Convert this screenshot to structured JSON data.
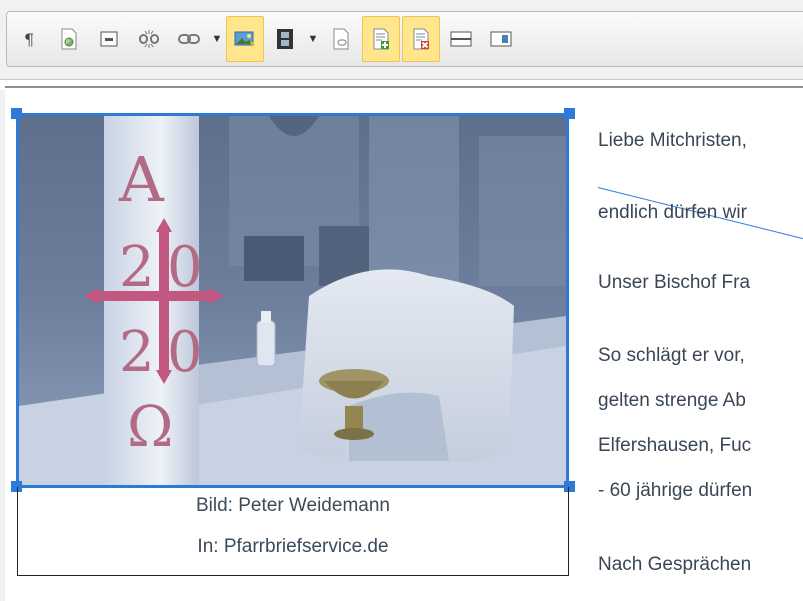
{
  "toolbar": {
    "buttons": [
      {
        "name": "paragraph-marks-icon",
        "active": false
      },
      {
        "name": "insert-page-icon",
        "active": false
      },
      {
        "name": "insert-field-icon",
        "active": false
      },
      {
        "name": "unlink-icon",
        "active": false
      },
      {
        "name": "link-icon",
        "active": false
      },
      {
        "name": "insert-image-icon",
        "active": true
      },
      {
        "name": "insert-media-icon",
        "active": false
      },
      {
        "name": "insert-document-link-icon",
        "active": false
      },
      {
        "name": "insert-table-row-icon",
        "active": true
      },
      {
        "name": "delete-table-row-icon",
        "active": true
      },
      {
        "name": "horizontal-rule-icon",
        "active": false
      },
      {
        "name": "template-icon",
        "active": false
      }
    ]
  },
  "image": {
    "caption_line1": "Bild: Peter Weidemann",
    "caption_line2": "In: Pfarrbriefservice.de",
    "candle_symbols": [
      "A",
      "2",
      "0",
      "2",
      "0",
      "Ω"
    ]
  },
  "body_lines": [
    "Liebe Mitchristen,",
    "endlich dürfen wir",
    "Unser Bischof Fra",
    "So schlägt er vor,",
    "gelten strenge Ab",
    "Elfershausen, Fuc",
    "- 60 jährige dürfen",
    "Nach Gesprächen"
  ],
  "colors": {
    "accent": "#2e7bd6",
    "toolbar_active": "#ffe58c"
  }
}
